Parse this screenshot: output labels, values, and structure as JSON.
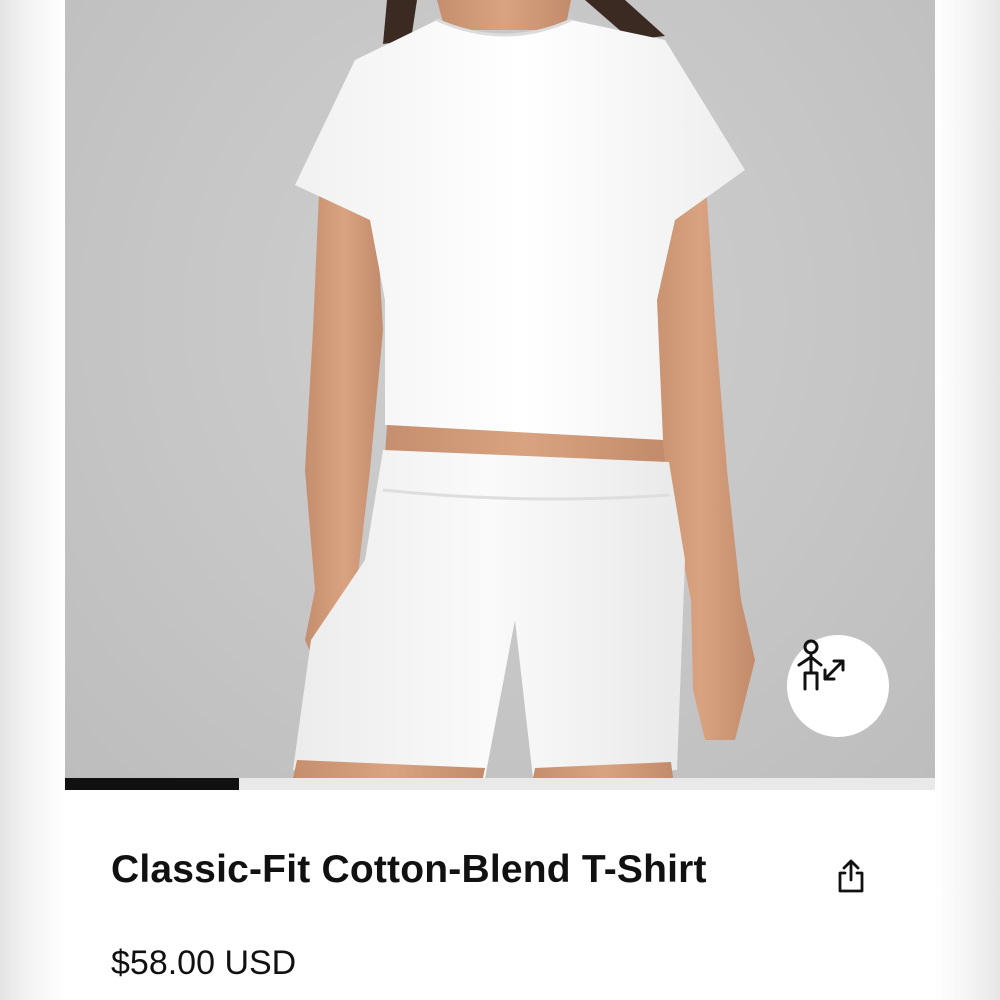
{
  "product": {
    "title": "Classic-Fit Cotton-Blend T-Shirt",
    "price": "$58.00 USD"
  },
  "gallery": {
    "image_subject": "model-wearing-white-tshirt-and-white-shorts",
    "progress_fraction": 0.2,
    "progress_color": "#111111"
  },
  "icons": {
    "fit": "body-fit-icon",
    "share": "share-icon"
  },
  "colors": {
    "background": "#ffffff",
    "text": "#111111",
    "hero_backdrop": "#c8c8c8"
  }
}
